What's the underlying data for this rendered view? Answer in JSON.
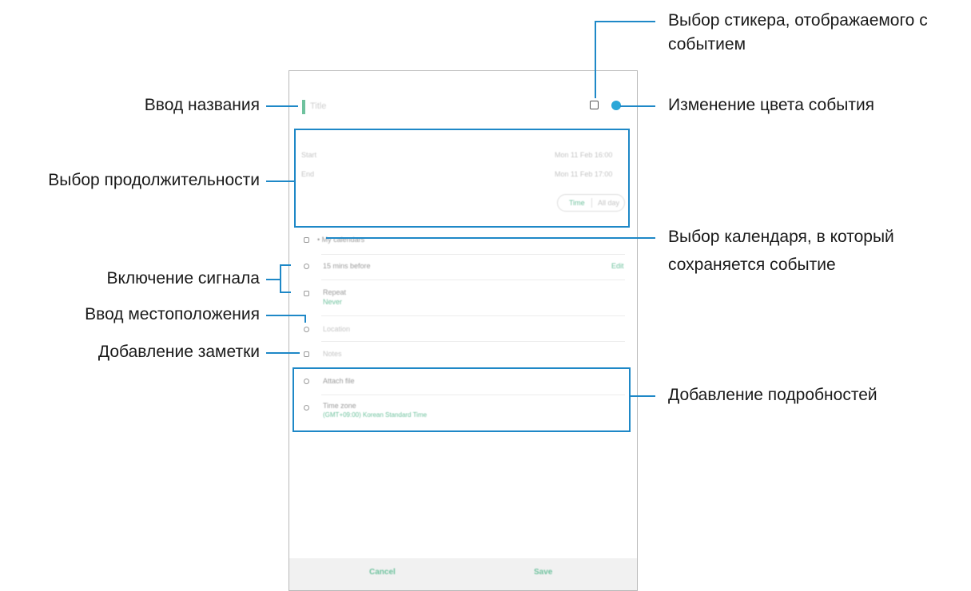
{
  "annotations": {
    "title_input": "Ввод названия",
    "duration": "Выбор продолжительности",
    "alarm": "Включение сигнала",
    "location": "Ввод местоположения",
    "note": "Добавление заметки",
    "sticker_line1": "Выбор стикера, отображаемого с",
    "sticker_line2": "событием",
    "color": "Изменение цвета события",
    "calendar_line1": "Выбор календаря, в который",
    "calendar_line2": "сохраняется событие",
    "details": "Добавление подробностей"
  },
  "colors": {
    "callout": "#1e88c7",
    "accent_green": "#6fc29e",
    "event_color_dot": "#2aa7d8"
  },
  "icons": [
    "sticker-icon",
    "color-dot-icon",
    "calendar-icon",
    "bell-icon",
    "repeat-icon",
    "location-pin-icon",
    "note-icon",
    "attach-icon",
    "globe-icon"
  ]
}
